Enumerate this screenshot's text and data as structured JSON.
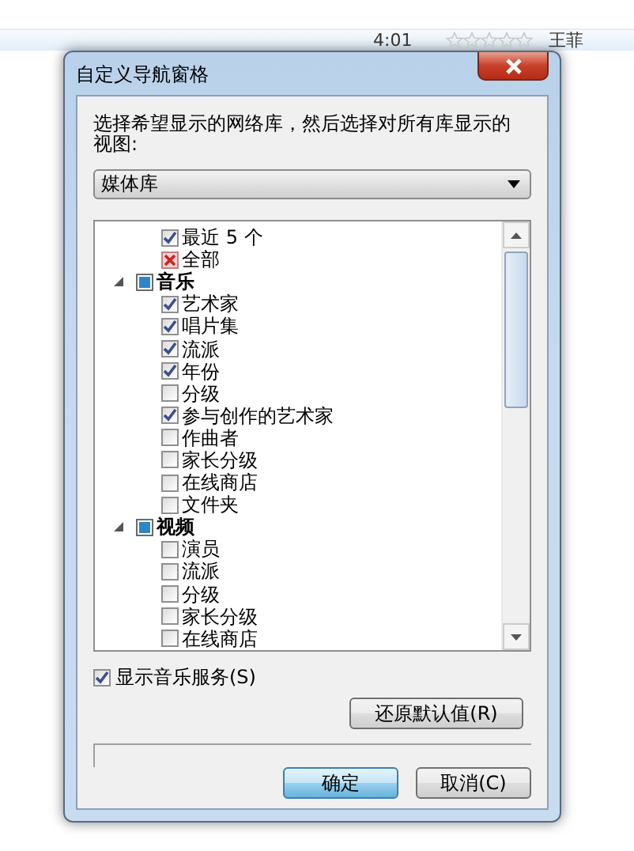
{
  "background_row": {
    "duration": "4:01",
    "stars": 0,
    "artist": "王菲"
  },
  "dialog": {
    "title": "自定义导航窗格",
    "instruction": "选择希望显示的网络库，然后选择对所有库显示的视图:",
    "library_select": {
      "value": "媒体库"
    },
    "tree": [
      {
        "children": [
          {
            "kind": "check",
            "label": "最近 5 个",
            "checked": true
          },
          {
            "kind": "exclude",
            "label": "全部",
            "checked": true
          }
        ]
      },
      {
        "label": "音乐",
        "expanded": true,
        "partial": true,
        "children": [
          {
            "kind": "check",
            "label": "艺术家",
            "checked": true
          },
          {
            "kind": "check",
            "label": "唱片集",
            "checked": true
          },
          {
            "kind": "check",
            "label": "流派",
            "checked": true
          },
          {
            "kind": "check",
            "label": "年份",
            "checked": true
          },
          {
            "kind": "check",
            "label": "分级",
            "checked": false
          },
          {
            "kind": "check",
            "label": "参与创作的艺术家",
            "checked": true
          },
          {
            "kind": "check",
            "label": "作曲者",
            "checked": false
          },
          {
            "kind": "check",
            "label": "家长分级",
            "checked": false
          },
          {
            "kind": "check",
            "label": "在线商店",
            "checked": false
          },
          {
            "kind": "check",
            "label": "文件夹",
            "checked": false
          }
        ]
      },
      {
        "label": "视频",
        "expanded": true,
        "partial": true,
        "children": [
          {
            "kind": "check",
            "label": "演员",
            "checked": false
          },
          {
            "kind": "check",
            "label": "流派",
            "checked": false
          },
          {
            "kind": "check",
            "label": "分级",
            "checked": false
          },
          {
            "kind": "check",
            "label": "家长分级",
            "checked": false
          },
          {
            "kind": "check",
            "label": "在线商店",
            "checked": false
          }
        ]
      }
    ],
    "show_music_services": {
      "label": "显示音乐服务(S)",
      "checked": true
    },
    "restore_button": "还原默认值(R)",
    "buttons": [
      "确定",
      "取消(C)"
    ]
  }
}
